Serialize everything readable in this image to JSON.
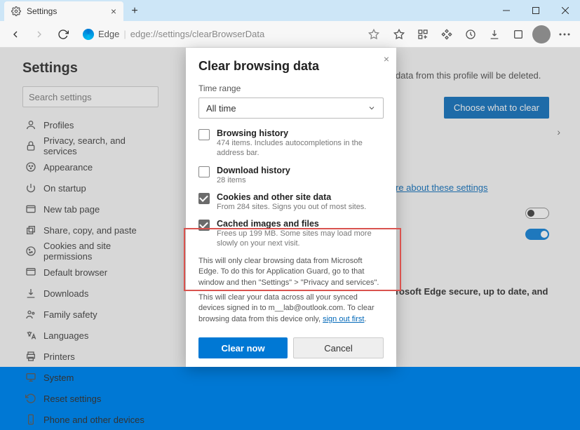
{
  "window": {
    "tab_title": "Settings",
    "address_label": "Edge",
    "address_url": "edge://settings/clearBrowserData"
  },
  "sidebar": {
    "title": "Settings",
    "search_placeholder": "Search settings",
    "items": [
      {
        "icon": "profile",
        "label": "Profiles"
      },
      {
        "icon": "lock",
        "label": "Privacy, search, and services"
      },
      {
        "icon": "appearance",
        "label": "Appearance"
      },
      {
        "icon": "power",
        "label": "On startup"
      },
      {
        "icon": "newtab",
        "label": "New tab page"
      },
      {
        "icon": "share",
        "label": "Share, copy, and paste"
      },
      {
        "icon": "cookies",
        "label": "Cookies and site permissions"
      },
      {
        "icon": "browser",
        "label": "Default browser"
      },
      {
        "icon": "download",
        "label": "Downloads"
      },
      {
        "icon": "family",
        "label": "Family safety"
      },
      {
        "icon": "lang",
        "label": "Languages"
      },
      {
        "icon": "printer",
        "label": "Printers"
      },
      {
        "icon": "system",
        "label": "System"
      },
      {
        "icon": "reset",
        "label": "Reset settings"
      },
      {
        "icon": "phone",
        "label": "Phone and other devices"
      }
    ]
  },
  "main": {
    "profile_note": "data from this profile will be deleted.",
    "choose_button": "Choose what to clear",
    "learn_link": "re about these settings",
    "secure_text": "rosoft Edge secure, up to date, and"
  },
  "dialog": {
    "title": "Clear browsing data",
    "time_label": "Time range",
    "time_value": "All time",
    "options": [
      {
        "checked": false,
        "title": "Browsing history",
        "sub": "474 items. Includes autocompletions in the address bar."
      },
      {
        "checked": false,
        "title": "Download history",
        "sub": "28 items"
      },
      {
        "checked": true,
        "title": "Cookies and other site data",
        "sub": "From 284 sites. Signs you out of most sites."
      },
      {
        "checked": true,
        "title": "Cached images and files",
        "sub": "Frees up 199 MB. Some sites may load more slowly on your next visit."
      }
    ],
    "note1": "This will only clear browsing data from Microsoft Edge. To do this for Application Guard, go to that window and then \"Settings\" > \"Privacy and services\".",
    "note2_a": "This will clear your data across all your synced devices signed in to m__lab@outlook.com. To clear browsing data from this device only, ",
    "note2_link": "sign out first",
    "note2_b": ".",
    "clear_btn": "Clear now",
    "cancel_btn": "Cancel"
  }
}
